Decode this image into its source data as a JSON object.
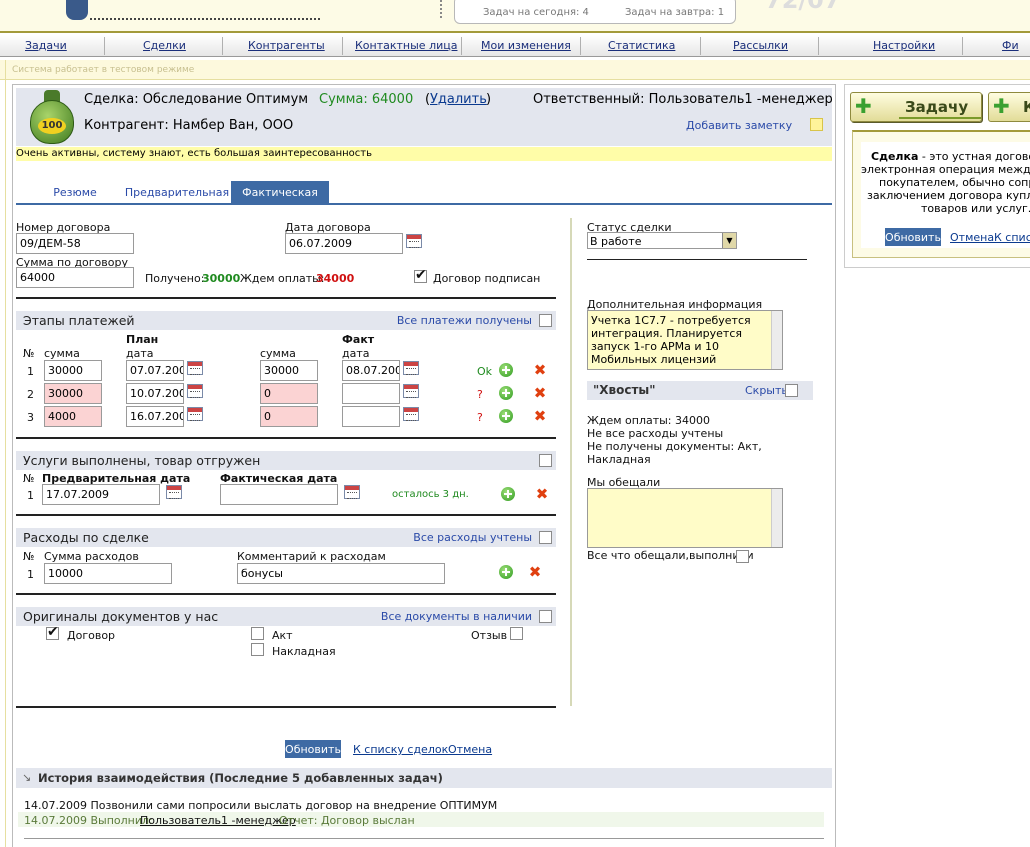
{
  "header": {
    "tasks_today": "Задач на сегодня: 4",
    "tasks_tomorrow": "Задач на завтра: 1",
    "big_number": "72/07"
  },
  "nav": [
    "Задачи",
    "Сделки",
    "Контрагенты",
    "Контактные лица",
    "Мои изменения",
    "Статистика",
    "Рассылки",
    "Настройки",
    "Фи"
  ],
  "test_mode": "Система работает в тестовом режиме",
  "deal": {
    "title": "Сделка: Обследование Оптимум",
    "sum": "Сумма: 64000",
    "delete_open": "(",
    "delete": "Удалить",
    "delete_close": ")",
    "responsible": "Ответственный: Пользователь1 -менеджер",
    "counterparty": "Контрагент: Намбер Ван, ООО",
    "add_note": "Добавить заметку",
    "note": "Очень активны, систему знают, есть большая заинтересованность",
    "bag_label": "100"
  },
  "tabs": [
    "Резюме",
    "Предварительная",
    "Фактическая"
  ],
  "contract": {
    "number_label": "Номер договора",
    "number": "09/ДЕМ-58",
    "date_label": "Дата договора",
    "date": "06.07.2009",
    "sum_label": "Сумма по договору",
    "sum": "64000",
    "received_label": "Получено:",
    "received": "30000",
    "waiting_label": "Ждем оплаты:",
    "waiting": "34000",
    "signed": "Договор подписан"
  },
  "payments": {
    "title": "Этапы платежей",
    "all_received": "Все платежи получены",
    "plan": "План",
    "fact": "Факт",
    "num": "№",
    "sum": "сумма",
    "date": "дата",
    "rows": [
      {
        "n": "1",
        "plan_sum": "30000",
        "plan_date": "07.07.200",
        "fact_sum": "30000",
        "fact_date": "08.07.200",
        "status": "Ok"
      },
      {
        "n": "2",
        "plan_sum": "30000",
        "plan_date": "10.07.200",
        "fact_sum": "0",
        "fact_date": "",
        "status": "?"
      },
      {
        "n": "3",
        "plan_sum": "4000",
        "plan_date": "16.07.200",
        "fact_sum": "0",
        "fact_date": "",
        "status": "?"
      }
    ]
  },
  "services": {
    "title": "Услуги выполнены, товар отгружен",
    "num": "№",
    "prelim_label": "Предварительная дата",
    "actual_label": "Фактическая дата",
    "row_n": "1",
    "prelim": "17.07.2009",
    "actual": "",
    "left": "осталось 3 дн."
  },
  "expenses": {
    "title": "Расходы по сделке",
    "all_counted": "Все расходы учтены",
    "num": "№",
    "sum_label": "Сумма расходов",
    "comment_label": "Комментарий к расходам",
    "row_n": "1",
    "sum": "10000",
    "comment": "бонусы"
  },
  "originals": {
    "title": "Оригиналы документов у нас",
    "all_present": "Все документы в наличии",
    "contract": "Договор",
    "act": "Акт",
    "invoice": "Накладная",
    "review": "Отзыв"
  },
  "actions": {
    "update": "Обновить",
    "to_list": "К списку сделок",
    "cancel": "Отмена"
  },
  "history": {
    "title": "История взаимодействия (Последние 5 добавленных задач)",
    "line1": "14.07.2009 Позвонили сами попросили выслать договор на внедрение ОПТИМУМ",
    "line2_date": "14.07.2009 Выполнил:",
    "line2_user": "Пользователь1 -менеджер",
    "line2_rest": "Отчет: Договор выслан"
  },
  "status": {
    "label": "Статус сделки",
    "value": "В работе"
  },
  "extra": {
    "label": "Дополнительная информация",
    "text": "Учетка 1С7.7 - потребуется интеграция. Планируется запуск 1-го АРМа и 10 Мобильных лицензий"
  },
  "tails": {
    "title": "\"Хвосты\"",
    "hide": "Скрыть",
    "l1": "Ждем оплаты: 34000",
    "l2": "Не все расходы учтены",
    "l3": "Не получены документы: Акт,",
    "l4": "Накладная"
  },
  "promised": {
    "label": "Мы обещали",
    "done": "Все что обещали,выполнили"
  },
  "sidebar": {
    "task_btn": "Задачу",
    "k_btn": "К",
    "def_bold": "Сделка",
    "def_l1": " - это устная договоре",
    "def_l2": "электронная операция между п",
    "def_l3": "покупателем, обычно сопров",
    "def_l4": "заключением договора купли",
    "def_l5": "товаров или услуг.",
    "update": "Обновить",
    "cancel": "Отмена",
    "to_list": "К списк"
  }
}
